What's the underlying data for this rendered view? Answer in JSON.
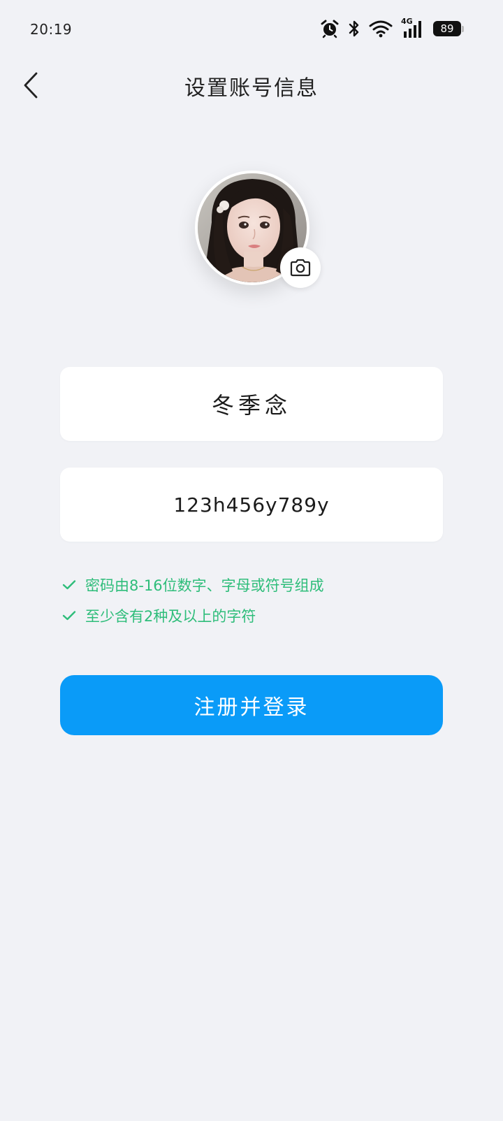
{
  "status_bar": {
    "time": "20:19",
    "network": "4G",
    "battery": "89",
    "icons": [
      "alarm-icon",
      "bluetooth-icon",
      "wifi-icon",
      "signal-icon",
      "battery-icon"
    ]
  },
  "header": {
    "title": "设置账号信息",
    "back_icon": "chevron-left-icon"
  },
  "avatar": {
    "camera_icon": "camera-icon"
  },
  "form": {
    "nickname_value": "冬季念",
    "password_value": "123h456y789y"
  },
  "rules": [
    {
      "icon": "check-icon",
      "text": "密码由8-16位数字、字母或符号组成"
    },
    {
      "icon": "check-icon",
      "text": "至少含有2种及以上的字符"
    }
  ],
  "submit_label": "注册并登录",
  "colors": {
    "background": "#f1f2f6",
    "primary": "#0a9bf8",
    "success": "#2ebd7a"
  }
}
